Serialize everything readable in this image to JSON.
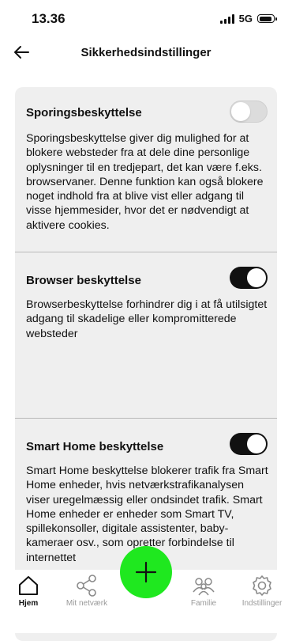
{
  "status_bar": {
    "time": "13.36",
    "network": "5G"
  },
  "header": {
    "title": "Sikkerhedsindstillinger",
    "back_icon": "arrow-left-icon"
  },
  "sections": [
    {
      "title": "Sporingsbeskyttelse",
      "description": "Sporingsbeskyttelse giver dig mulighed for at blokere websteder fra at dele dine personlige oplysninger til en tredjepart, det kan være f.eks. browservaner. Denne funktion kan også blokere noget indhold fra at blive vist eller adgang til visse hjemmesider, hvor det er nødvendigt at aktivere cookies.",
      "enabled": false
    },
    {
      "title": "Browser beskyttelse",
      "description": "Browserbeskyttelse forhindrer dig i at få utilsigtet adgang til skadelige eller kompromitterede websteder",
      "enabled": true
    },
    {
      "title": "Smart Home beskyttelse",
      "description": "Smart Home beskyttelse blokerer trafik fra Smart Home enheder, hvis netværkstrafikanalysen viser uregelmæssig eller ondsindet trafik. Smart Home enheder er enheder som Smart TV, spillekonsoller, digitale assistenter, baby-kameraer osv., som opretter forbindelse til internettet",
      "enabled": true
    }
  ],
  "bottom_nav": {
    "items": [
      {
        "label": "Hjem",
        "icon": "home-icon",
        "active": true
      },
      {
        "label": "Mit netværk",
        "icon": "share-network-icon",
        "active": false
      },
      {
        "label": "Familie",
        "icon": "family-icon",
        "active": false
      },
      {
        "label": "Indstillinger",
        "icon": "gear-icon",
        "active": false
      }
    ],
    "fab_icon": "plus-icon"
  },
  "colors": {
    "accent": "#1fe81f",
    "card_bg": "#efefef",
    "toggle_on": "#111111",
    "toggle_off": "#dcdcdc"
  }
}
